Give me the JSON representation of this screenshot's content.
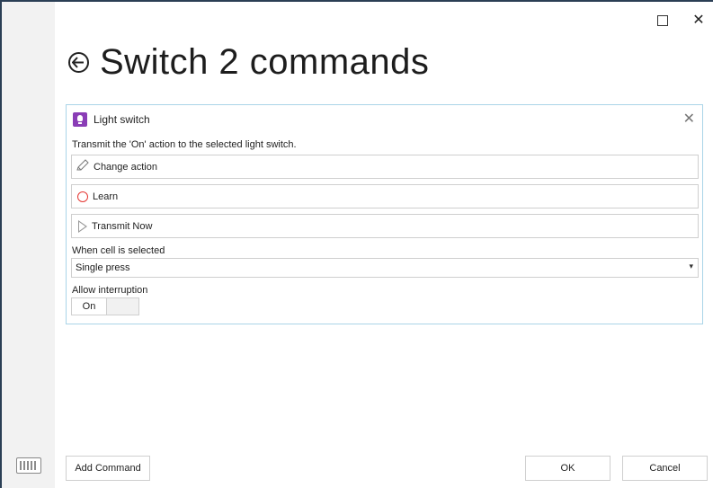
{
  "window": {
    "title": "Switch 2 commands",
    "maximize_icon": "maximize-icon",
    "close_icon": "close-icon",
    "close_glyph": "✕"
  },
  "command": {
    "name": "Light switch",
    "description": "Transmit the 'On' action to the selected light switch.",
    "change_action_label": "Change action",
    "learn_label": "Learn",
    "transmit_label": "Transmit Now",
    "close_glyph": "✕"
  },
  "cell_selected": {
    "label": "When cell is selected",
    "value": "Single press",
    "arrow": "▾"
  },
  "interruption": {
    "label": "Allow interruption",
    "state": "On"
  },
  "buttons": {
    "add_command": "Add Command",
    "ok": "OK",
    "cancel": "Cancel"
  },
  "colors": {
    "accent_purple": "#8a3db6",
    "learn_red": "#e53935",
    "panel_border": "#aad4e8"
  }
}
